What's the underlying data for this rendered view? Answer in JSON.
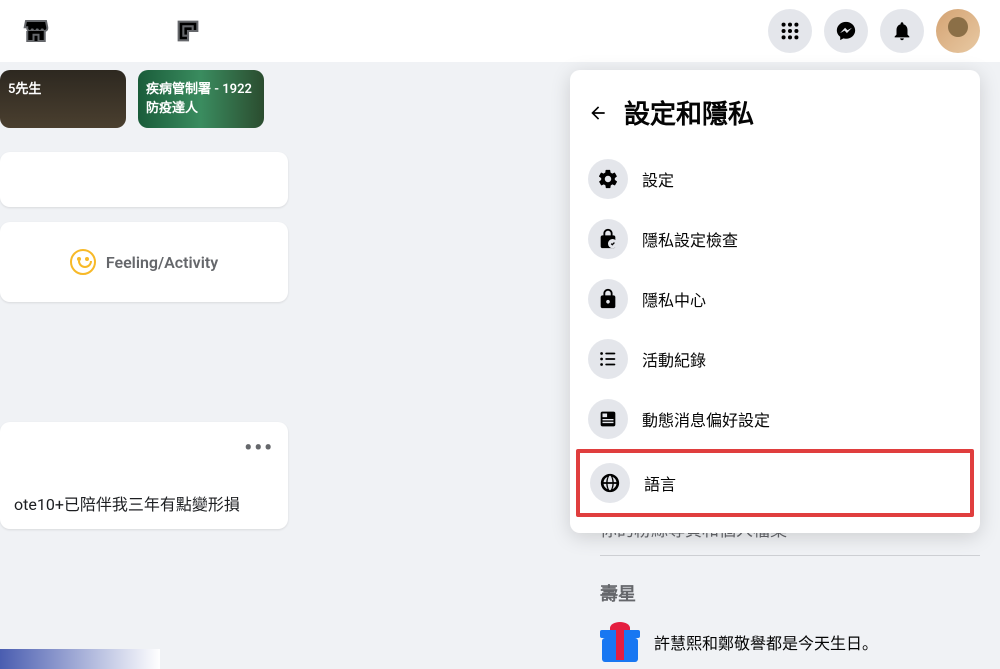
{
  "header": {
    "icons": {
      "marketplace": "marketplace",
      "gaming": "gaming",
      "menu": "menu",
      "messenger": "messenger",
      "notifications": "notifications"
    }
  },
  "stories": [
    {
      "label": "5先生"
    },
    {
      "label": "疾病管制署 - 1922 防疫達人"
    }
  ],
  "composer": {
    "feeling_activity": "Feeling/Activity"
  },
  "post": {
    "text": "ote10+已陪伴我三年有點變形損"
  },
  "dropdown": {
    "title": "設定和隱私",
    "items": [
      {
        "icon": "gear",
        "label": "設定"
      },
      {
        "icon": "lock-check",
        "label": "隱私設定檢查"
      },
      {
        "icon": "lock",
        "label": "隱私中心"
      },
      {
        "icon": "list",
        "label": "活動紀錄"
      },
      {
        "icon": "feed",
        "label": "動態消息偏好設定"
      },
      {
        "icon": "globe",
        "label": "語言"
      }
    ]
  },
  "sidebar": {
    "obscured_text": "你的粉絲專頁和個人檔案",
    "birthday_title": "壽星",
    "birthday_text": "許慧熙和鄭敬譽都是今天生日。"
  }
}
